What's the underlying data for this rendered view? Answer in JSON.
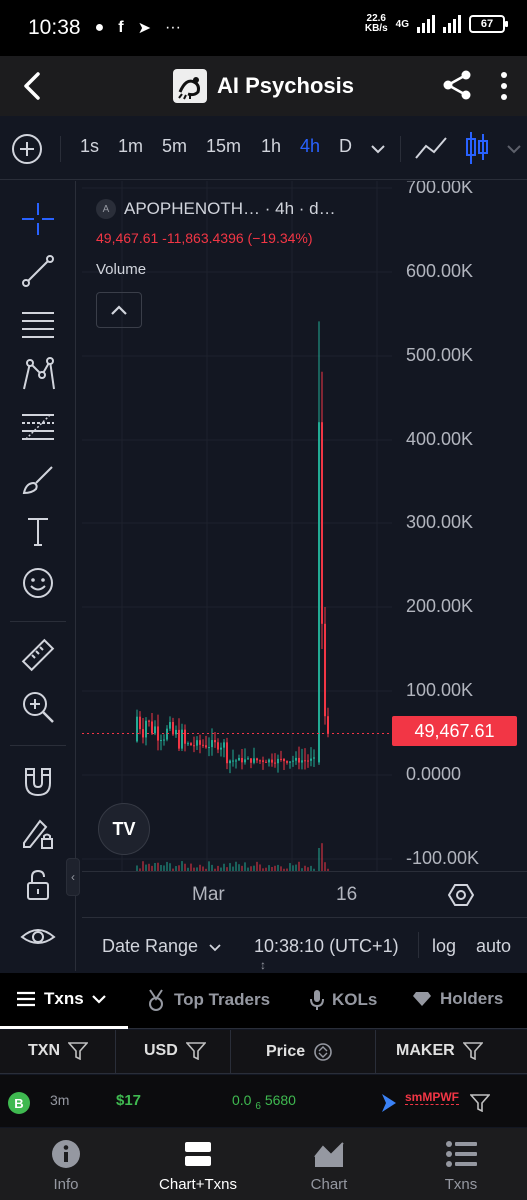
{
  "status_bar": {
    "time": "10:38",
    "speed_value": "22.6",
    "speed_unit": "KB/s",
    "network": "4G",
    "battery": "67"
  },
  "header": {
    "title": "AI Psychosis"
  },
  "intervals": [
    "1s",
    "1m",
    "5m",
    "15m",
    "1h",
    "4h",
    "D"
  ],
  "active_interval": "4h",
  "legend": {
    "symbol": "APOPHENOTH… · 4h · d…",
    "badge": "A",
    "ohlc": "49,467.61  -11,863.4396 (−19.34%)",
    "volume_label": "Volume"
  },
  "price_axis": {
    "ticks": [
      "700.00K",
      "600.00K",
      "500.00K",
      "400.00K",
      "300.00K",
      "200.00K",
      "100.00K",
      "0.0000",
      "-100.00K"
    ],
    "current_price": "49,467.61"
  },
  "time_axis": {
    "ticks": [
      "Mar",
      "16"
    ]
  },
  "controls": {
    "date_range": "Date Range",
    "clock": "10:38:10 (UTC+1)",
    "log": "log",
    "auto": "auto"
  },
  "tabs": [
    {
      "label": "Txns",
      "icon": "list-icon"
    },
    {
      "label": "Top Traders",
      "icon": "medal-icon"
    },
    {
      "label": "KOLs",
      "icon": "mic-icon"
    },
    {
      "label": "Holders",
      "icon": "diamond-icon"
    }
  ],
  "table": {
    "headers": [
      "TXN",
      "USD",
      "Price",
      "MAKER"
    ],
    "rows": [
      {
        "type": "B",
        "age": "3m",
        "usd": "$17",
        "price_main": "0.0",
        "price_sub": "6",
        "price_rest": "5680",
        "maker": "smMPWF"
      }
    ]
  },
  "bottom_nav": [
    {
      "label": "Info",
      "icon": "info-icon"
    },
    {
      "label": "Chart+Txns",
      "icon": "chart-txns-icon"
    },
    {
      "label": "Chart",
      "icon": "area-chart-icon"
    },
    {
      "label": "Txns",
      "icon": "txns-list-icon"
    }
  ],
  "colors": {
    "up": "#22ab94",
    "down": "#f23645",
    "accent": "#2962ff",
    "buy": "#3fb950"
  }
}
